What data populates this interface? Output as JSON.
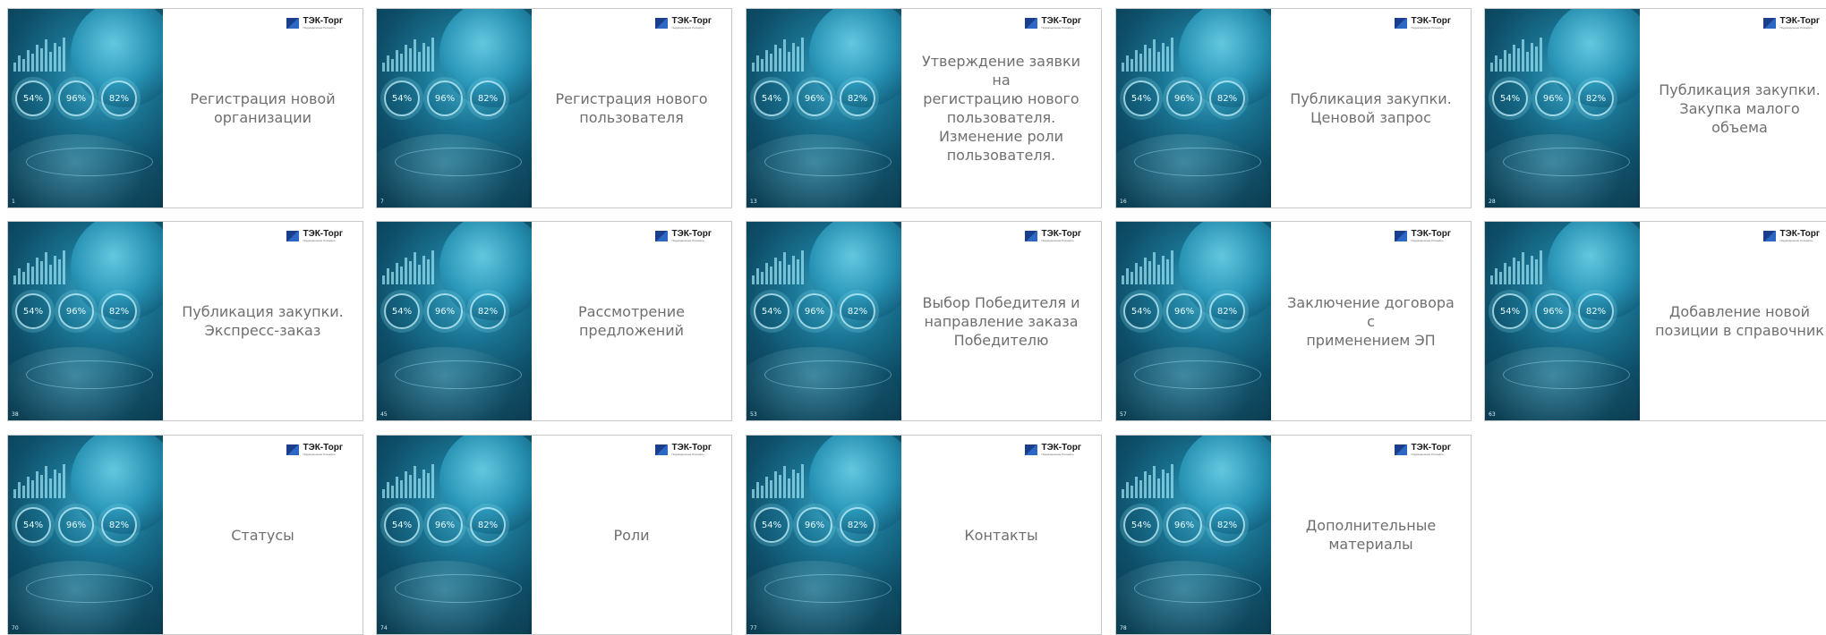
{
  "brand": {
    "name": "ТЭК-Торг",
    "tagline": "Подразделение Роснефть"
  },
  "art": {
    "dial_values": [
      "54%",
      "96%",
      "82%"
    ]
  },
  "slides": [
    {
      "title": "Регистрация новой\nорганизации",
      "number": "1"
    },
    {
      "title": "Регистрация нового\nпользователя",
      "number": "7"
    },
    {
      "title": "Утверждение заявки на\nрегистрацию нового\nпользователя.\nИзменение роли\nпользователя.",
      "number": "13"
    },
    {
      "title": "Публикация закупки.\nЦеновой запрос",
      "number": "16"
    },
    {
      "title": "Публикация закупки.\nЗакупка малого объема",
      "number": "28"
    },
    {
      "title": "Публикация закупки.\nЭкспресс-заказ",
      "number": "38"
    },
    {
      "title": "Рассмотрение\nпредложений",
      "number": "45"
    },
    {
      "title": "Выбор Победителя и\nнаправление заказа\nПобедителю",
      "number": "53"
    },
    {
      "title": "Заключение договора с\nприменением ЭП",
      "number": "57"
    },
    {
      "title": "Добавление новой\nпозиции в справочник",
      "number": "63"
    },
    {
      "title": "Статусы",
      "number": "70"
    },
    {
      "title": "Роли",
      "number": "74"
    },
    {
      "title": "Контакты",
      "number": "77"
    },
    {
      "title": "Дополнительные\nматериалы",
      "number": "78"
    }
  ]
}
